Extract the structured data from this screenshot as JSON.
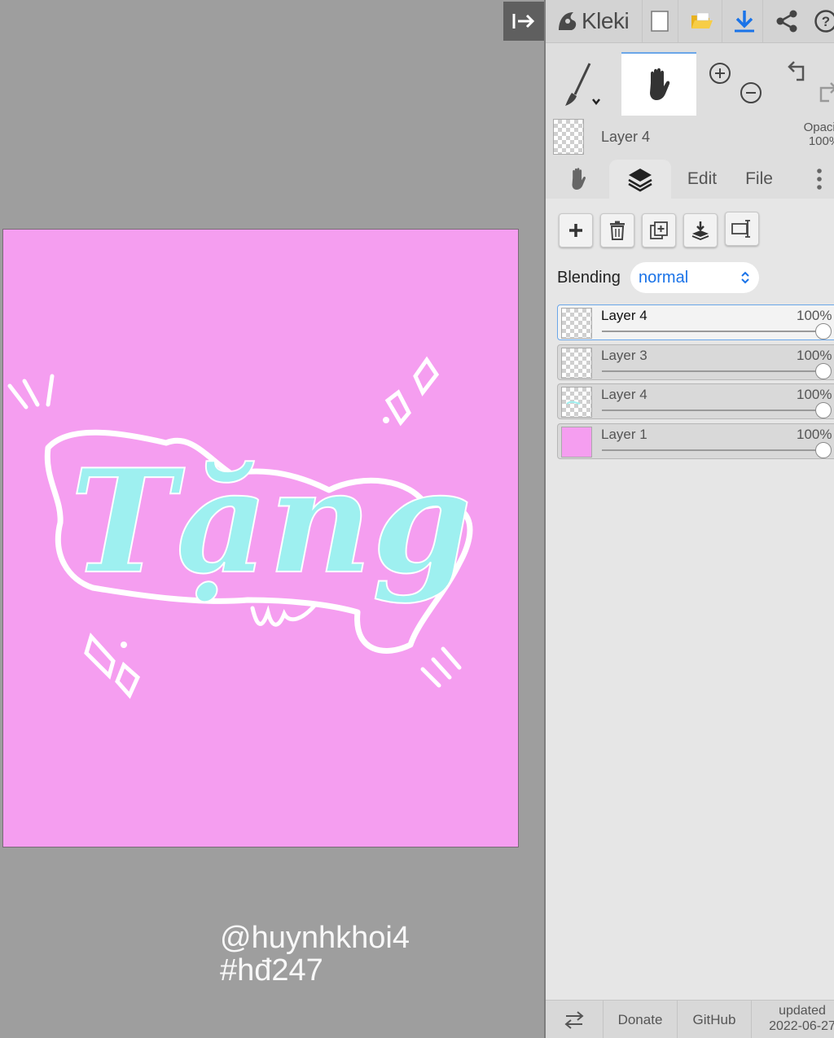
{
  "canvas": {
    "lettering": "Tặng",
    "handle_line1": "@huynhkhoi4",
    "handle_line2": "#hđ247",
    "background_color": "#f59ef0",
    "letter_color": "#9ef0f0"
  },
  "app": {
    "logo_text": "Kleki",
    "icons": [
      "collapse-sidebar-icon",
      "kleki-logo-icon",
      "new-file-icon",
      "open-folder-icon",
      "download-icon",
      "share-icon",
      "help-icon"
    ]
  },
  "tools": {
    "icons": [
      "brush-icon",
      "hand-icon",
      "zoom-in-icon",
      "zoom-out-icon",
      "undo-icon",
      "redo-icon"
    ]
  },
  "current_layer": {
    "name": "Layer 4",
    "opacity_label": "Opacity",
    "opacity_value": "100%"
  },
  "tabs": {
    "edit": "Edit",
    "file": "File"
  },
  "layers_panel": {
    "blending_label": "Blending",
    "blending_value": "normal",
    "layers": [
      {
        "name": "Layer 4",
        "opacity": "100%",
        "selected": true,
        "level": 1.0
      },
      {
        "name": "Layer 3",
        "opacity": "100%",
        "selected": false,
        "level": 1.0
      },
      {
        "name": "Layer 4",
        "opacity": "100%",
        "selected": false,
        "level": 1.0
      },
      {
        "name": "Layer 1",
        "opacity": "100%",
        "selected": false,
        "level": 1.0
      }
    ]
  },
  "footer": {
    "donate": "Donate",
    "github": "GitHub",
    "updated_label": "updated",
    "updated_date": "2022-06-27"
  }
}
